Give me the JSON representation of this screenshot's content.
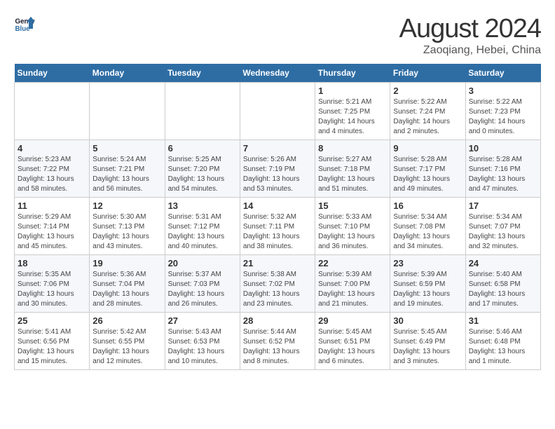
{
  "logo": {
    "line1": "General",
    "line2": "Blue"
  },
  "title": "August 2024",
  "subtitle": "Zaoqiang, Hebei, China",
  "weekdays": [
    "Sunday",
    "Monday",
    "Tuesday",
    "Wednesday",
    "Thursday",
    "Friday",
    "Saturday"
  ],
  "weeks": [
    [
      {
        "day": "",
        "info": ""
      },
      {
        "day": "",
        "info": ""
      },
      {
        "day": "",
        "info": ""
      },
      {
        "day": "",
        "info": ""
      },
      {
        "day": "1",
        "info": "Sunrise: 5:21 AM\nSunset: 7:25 PM\nDaylight: 14 hours\nand 4 minutes."
      },
      {
        "day": "2",
        "info": "Sunrise: 5:22 AM\nSunset: 7:24 PM\nDaylight: 14 hours\nand 2 minutes."
      },
      {
        "day": "3",
        "info": "Sunrise: 5:22 AM\nSunset: 7:23 PM\nDaylight: 14 hours\nand 0 minutes."
      }
    ],
    [
      {
        "day": "4",
        "info": "Sunrise: 5:23 AM\nSunset: 7:22 PM\nDaylight: 13 hours\nand 58 minutes."
      },
      {
        "day": "5",
        "info": "Sunrise: 5:24 AM\nSunset: 7:21 PM\nDaylight: 13 hours\nand 56 minutes."
      },
      {
        "day": "6",
        "info": "Sunrise: 5:25 AM\nSunset: 7:20 PM\nDaylight: 13 hours\nand 54 minutes."
      },
      {
        "day": "7",
        "info": "Sunrise: 5:26 AM\nSunset: 7:19 PM\nDaylight: 13 hours\nand 53 minutes."
      },
      {
        "day": "8",
        "info": "Sunrise: 5:27 AM\nSunset: 7:18 PM\nDaylight: 13 hours\nand 51 minutes."
      },
      {
        "day": "9",
        "info": "Sunrise: 5:28 AM\nSunset: 7:17 PM\nDaylight: 13 hours\nand 49 minutes."
      },
      {
        "day": "10",
        "info": "Sunrise: 5:28 AM\nSunset: 7:16 PM\nDaylight: 13 hours\nand 47 minutes."
      }
    ],
    [
      {
        "day": "11",
        "info": "Sunrise: 5:29 AM\nSunset: 7:14 PM\nDaylight: 13 hours\nand 45 minutes."
      },
      {
        "day": "12",
        "info": "Sunrise: 5:30 AM\nSunset: 7:13 PM\nDaylight: 13 hours\nand 43 minutes."
      },
      {
        "day": "13",
        "info": "Sunrise: 5:31 AM\nSunset: 7:12 PM\nDaylight: 13 hours\nand 40 minutes."
      },
      {
        "day": "14",
        "info": "Sunrise: 5:32 AM\nSunset: 7:11 PM\nDaylight: 13 hours\nand 38 minutes."
      },
      {
        "day": "15",
        "info": "Sunrise: 5:33 AM\nSunset: 7:10 PM\nDaylight: 13 hours\nand 36 minutes."
      },
      {
        "day": "16",
        "info": "Sunrise: 5:34 AM\nSunset: 7:08 PM\nDaylight: 13 hours\nand 34 minutes."
      },
      {
        "day": "17",
        "info": "Sunrise: 5:34 AM\nSunset: 7:07 PM\nDaylight: 13 hours\nand 32 minutes."
      }
    ],
    [
      {
        "day": "18",
        "info": "Sunrise: 5:35 AM\nSunset: 7:06 PM\nDaylight: 13 hours\nand 30 minutes."
      },
      {
        "day": "19",
        "info": "Sunrise: 5:36 AM\nSunset: 7:04 PM\nDaylight: 13 hours\nand 28 minutes."
      },
      {
        "day": "20",
        "info": "Sunrise: 5:37 AM\nSunset: 7:03 PM\nDaylight: 13 hours\nand 26 minutes."
      },
      {
        "day": "21",
        "info": "Sunrise: 5:38 AM\nSunset: 7:02 PM\nDaylight: 13 hours\nand 23 minutes."
      },
      {
        "day": "22",
        "info": "Sunrise: 5:39 AM\nSunset: 7:00 PM\nDaylight: 13 hours\nand 21 minutes."
      },
      {
        "day": "23",
        "info": "Sunrise: 5:39 AM\nSunset: 6:59 PM\nDaylight: 13 hours\nand 19 minutes."
      },
      {
        "day": "24",
        "info": "Sunrise: 5:40 AM\nSunset: 6:58 PM\nDaylight: 13 hours\nand 17 minutes."
      }
    ],
    [
      {
        "day": "25",
        "info": "Sunrise: 5:41 AM\nSunset: 6:56 PM\nDaylight: 13 hours\nand 15 minutes."
      },
      {
        "day": "26",
        "info": "Sunrise: 5:42 AM\nSunset: 6:55 PM\nDaylight: 13 hours\nand 12 minutes."
      },
      {
        "day": "27",
        "info": "Sunrise: 5:43 AM\nSunset: 6:53 PM\nDaylight: 13 hours\nand 10 minutes."
      },
      {
        "day": "28",
        "info": "Sunrise: 5:44 AM\nSunset: 6:52 PM\nDaylight: 13 hours\nand 8 minutes."
      },
      {
        "day": "29",
        "info": "Sunrise: 5:45 AM\nSunset: 6:51 PM\nDaylight: 13 hours\nand 6 minutes."
      },
      {
        "day": "30",
        "info": "Sunrise: 5:45 AM\nSunset: 6:49 PM\nDaylight: 13 hours\nand 3 minutes."
      },
      {
        "day": "31",
        "info": "Sunrise: 5:46 AM\nSunset: 6:48 PM\nDaylight: 13 hours\nand 1 minute."
      }
    ]
  ]
}
